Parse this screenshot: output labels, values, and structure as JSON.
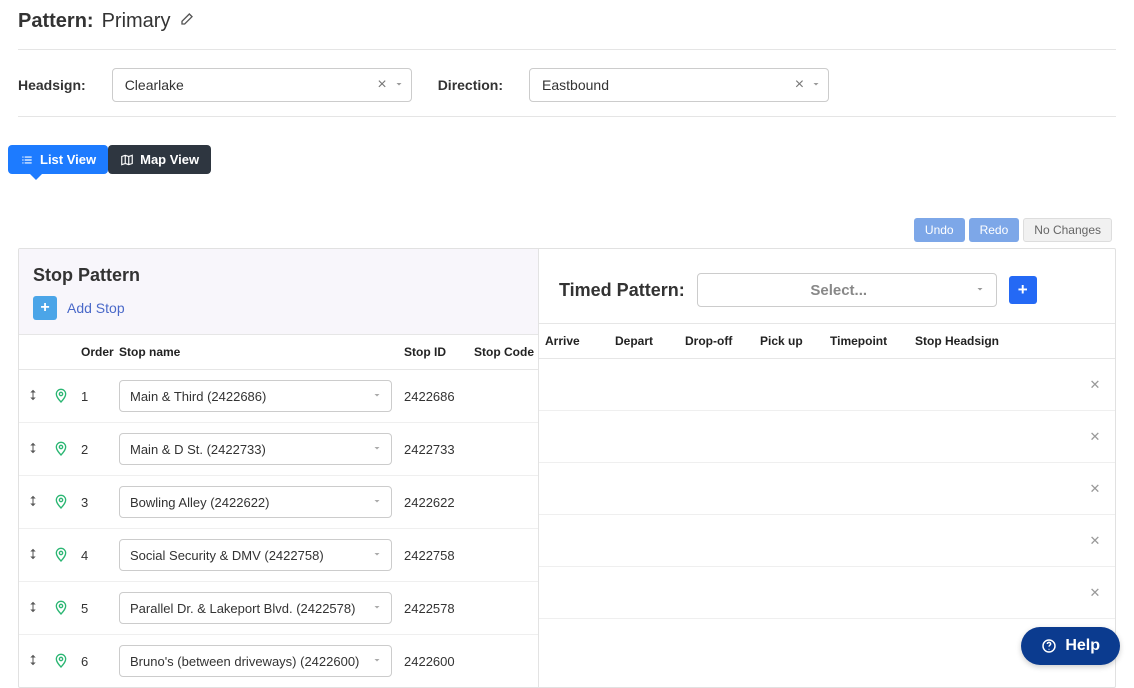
{
  "header": {
    "pattern_label": "Pattern:",
    "pattern_value": "Primary"
  },
  "meta": {
    "headsign_label": "Headsign:",
    "headsign_value": "Clearlake",
    "direction_label": "Direction:",
    "direction_value": "Eastbound"
  },
  "views": {
    "list": "List View",
    "map": "Map View"
  },
  "actions": {
    "undo": "Undo",
    "redo": "Redo",
    "status": "No Changes"
  },
  "left_panel": {
    "title": "Stop Pattern",
    "add_stop": "Add Stop"
  },
  "right_panel": {
    "title": "Timed Pattern:",
    "select_placeholder": "Select..."
  },
  "columns": {
    "order": "Order",
    "stop_name": "Stop name",
    "stop_id": "Stop ID",
    "stop_code": "Stop Code",
    "arrive": "Arrive",
    "depart": "Depart",
    "dropoff": "Drop-off",
    "pickup": "Pick up",
    "timepoint": "Timepoint",
    "stop_headsign": "Stop Headsign"
  },
  "stops": [
    {
      "order": "1",
      "name": "Main & Third (2422686)",
      "id": "2422686"
    },
    {
      "order": "2",
      "name": "Main & D St. (2422733)",
      "id": "2422733"
    },
    {
      "order": "3",
      "name": "Bowling Alley (2422622)",
      "id": "2422622"
    },
    {
      "order": "4",
      "name": "Social Security & DMV (2422758)",
      "id": "2422758"
    },
    {
      "order": "5",
      "name": "Parallel Dr. & Lakeport Blvd. (2422578)",
      "id": "2422578"
    },
    {
      "order": "6",
      "name": "Bruno's (between driveways) (2422600)",
      "id": "2422600"
    }
  ],
  "help": {
    "label": "Help"
  }
}
